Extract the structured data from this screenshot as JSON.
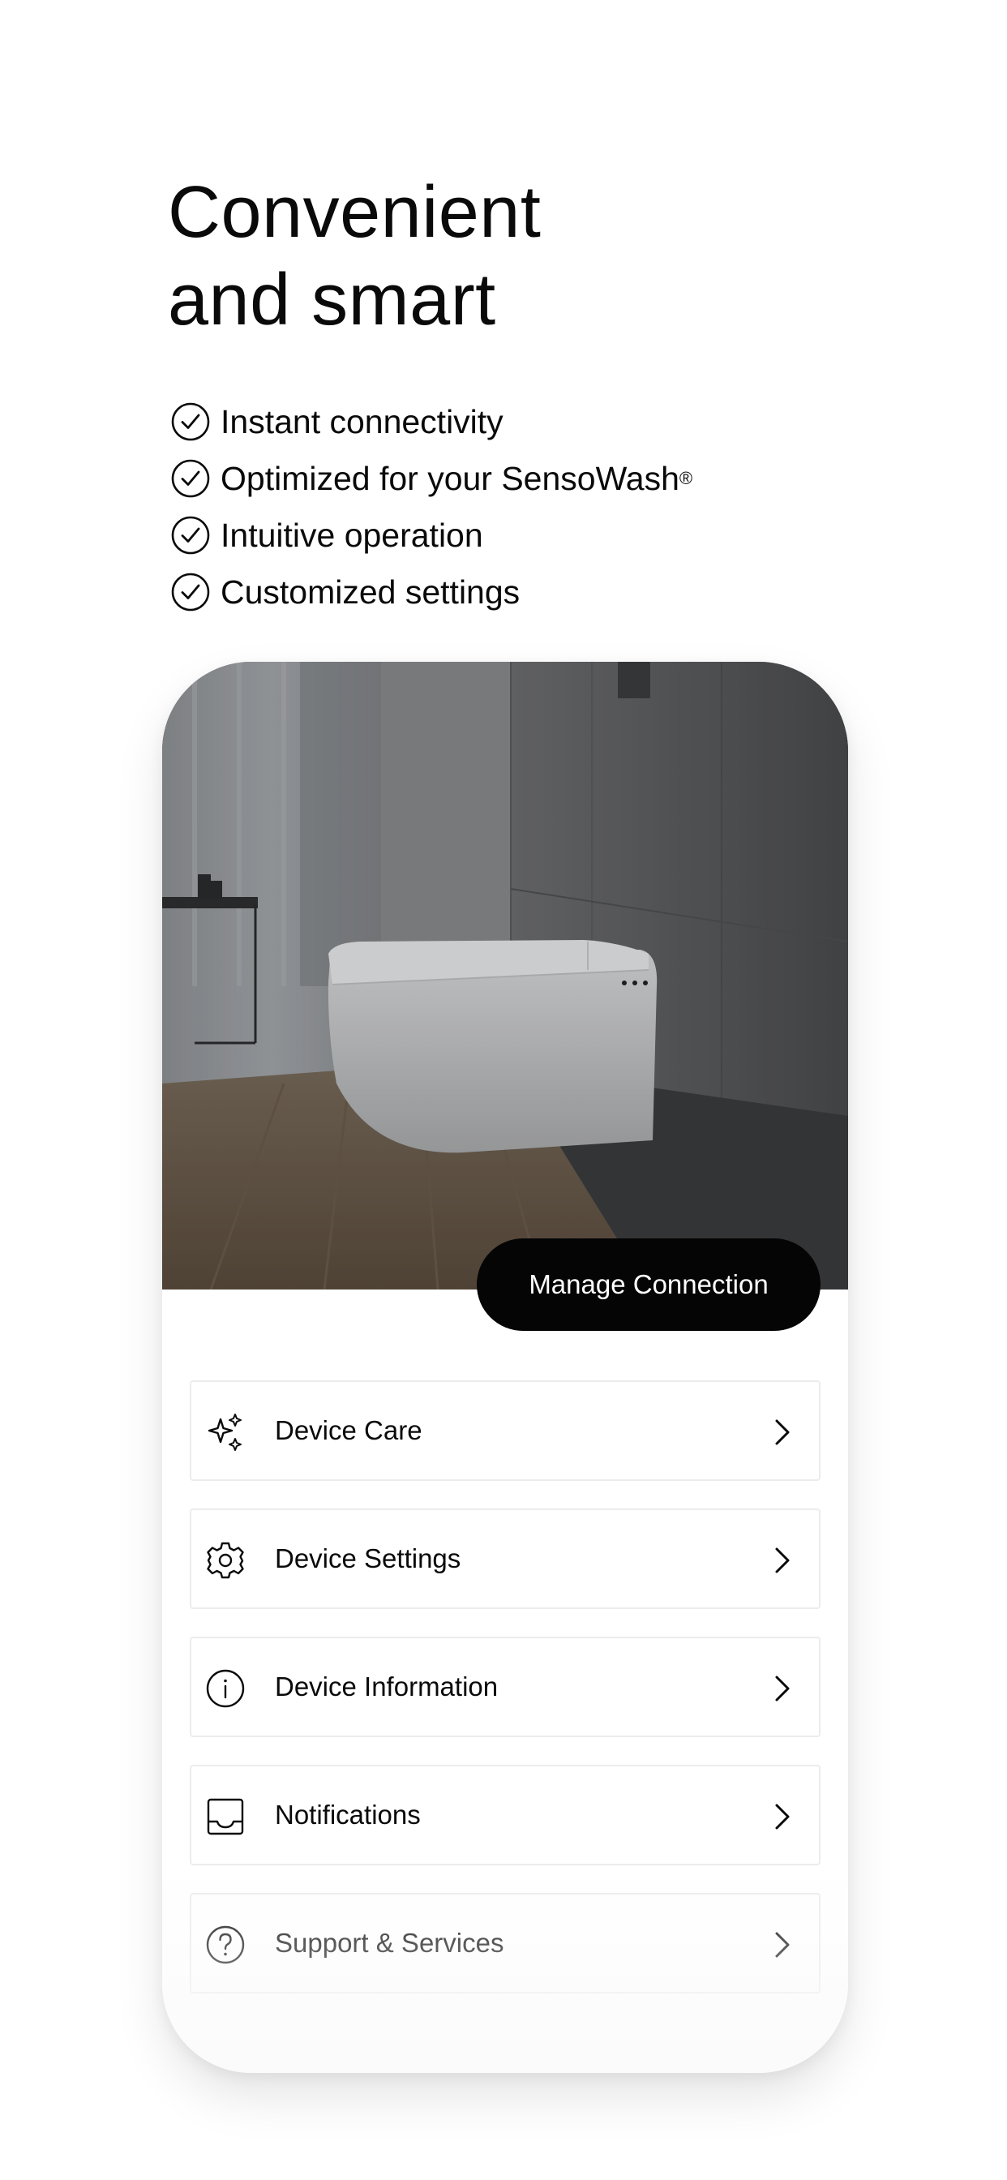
{
  "headline": {
    "line1": "Convenient",
    "line2": "and smart"
  },
  "features": [
    {
      "text": "Instant connectivity",
      "icon": "check-circle-icon"
    },
    {
      "text": "Optimized for your SensoWash",
      "sup": "®",
      "icon": "check-circle-icon"
    },
    {
      "text": "Intuitive operation",
      "icon": "check-circle-icon"
    },
    {
      "text": "Customized settings",
      "icon": "check-circle-icon"
    }
  ],
  "device": {
    "manage_connection_label": "Manage Connection",
    "menu": [
      {
        "label": "Device Care",
        "icon": "sparkle-icon"
      },
      {
        "label": "Device Settings",
        "icon": "gear-icon"
      },
      {
        "label": "Device Information",
        "icon": "info-circle-icon"
      },
      {
        "label": "Notifications",
        "icon": "inbox-icon"
      },
      {
        "label": "Support & Services",
        "icon": "question-circle-icon"
      }
    ]
  },
  "colors": {
    "text": "#0a0a0a",
    "button_bg": "#050505",
    "button_text": "#ffffff",
    "border": "#ececec"
  }
}
